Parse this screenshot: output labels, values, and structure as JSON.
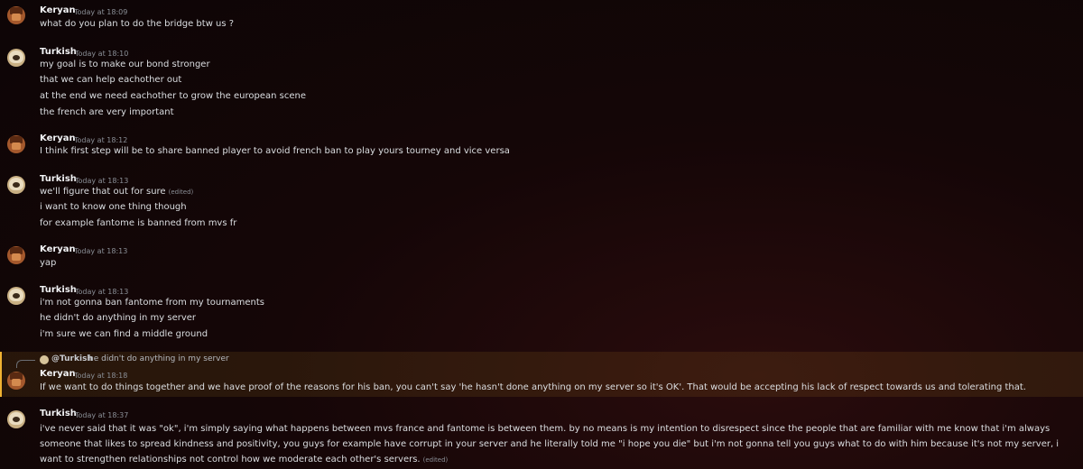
{
  "messages": [
    {
      "author": "Keryan",
      "timestamp": "Today at 18:09",
      "lines": [
        "what do you plan to do the bridge btw us ?"
      ]
    },
    {
      "author": "Turkish",
      "timestamp": "Today at 18:10",
      "lines": [
        "my goal is to make our bond stronger",
        "that we can help eachother out",
        "at the end we need eachother to grow the european scene",
        "the french are very important"
      ]
    },
    {
      "author": "Keryan",
      "timestamp": "Today at 18:12",
      "lines": [
        "I think first step will be to share banned player to avoid french ban to play yours tourney and vice versa"
      ]
    },
    {
      "author": "Turkish",
      "timestamp": "Today at 18:13",
      "lines": [
        "we'll figure that out for sure",
        "i want to know one thing though",
        "for example fantome is banned from mvs fr"
      ],
      "edited_label": "(edited)"
    },
    {
      "author": "Keryan",
      "timestamp": "Today at 18:13",
      "lines": [
        "yap"
      ]
    },
    {
      "author": "Turkish",
      "timestamp": "Today at 18:13",
      "lines": [
        "i'm not gonna ban fantome from my tournaments",
        "he didn't do anything in my server",
        "i'm sure we can find a middle ground"
      ]
    },
    {
      "author": "Keryan",
      "timestamp": "Today at 18:18",
      "reply": {
        "name": "@Turkish",
        "text": "he didn't do anything in my server"
      },
      "lines": [
        "If we want to do things together and we have proof of the reasons for his ban, you can't say 'he hasn't done anything on my server so it's OK'. That would be accepting his lack of respect towards us and tolerating that."
      ]
    },
    {
      "author": "Turkish",
      "timestamp": "Today at 18:37",
      "text": "i've never said that it was \"ok\", i'm simply saying what happens between mvs france and fantome is between them. by no means is my intention to disrespect since the people that are familiar with me know that i'm always someone that likes to spread kindness and positivity, you guys for example have corrupt in your server and he literally told me \"i hope you die\" but i'm not gonna tell you guys what to do with him because it's not my server, i want to strengthen relationships not control how we moderate each other's servers.",
      "edited_label": "(edited)"
    }
  ]
}
